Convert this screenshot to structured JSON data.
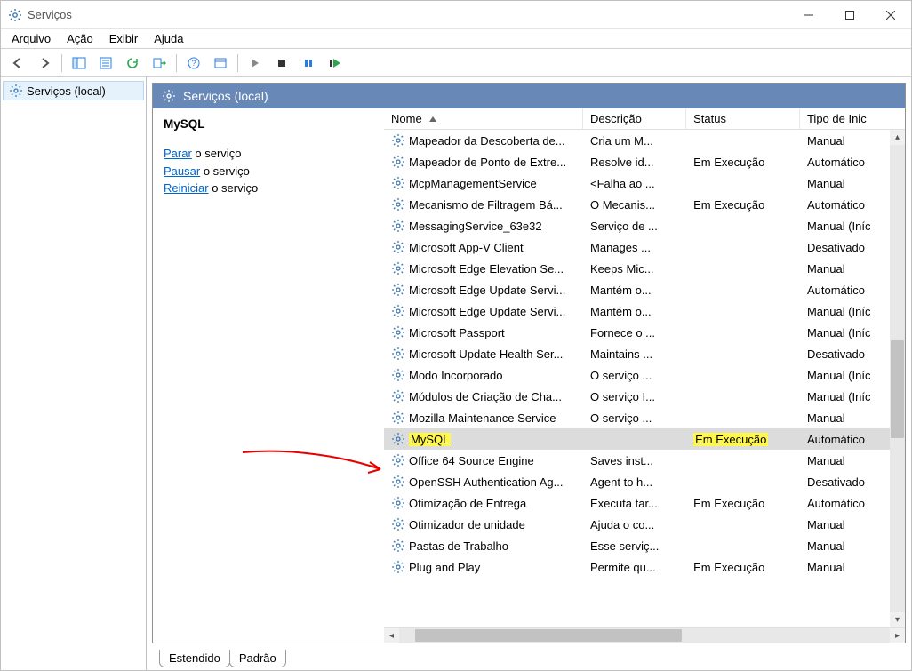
{
  "window": {
    "title": "Serviços"
  },
  "menu": {
    "file": "Arquivo",
    "action": "Ação",
    "view": "Exibir",
    "help": "Ajuda"
  },
  "tree": {
    "root": "Serviços (local)"
  },
  "pane": {
    "title": "Serviços (local)"
  },
  "detail": {
    "serviceName": "MySQL",
    "stopLink": "Parar",
    "stopText": " o serviço",
    "pauseLink": "Pausar",
    "pauseText": " o serviço",
    "restartLink": "Reiniciar",
    "restartText": " o serviço"
  },
  "columns": {
    "name": "Nome",
    "desc": "Descrição",
    "status": "Status",
    "start": "Tipo de Inic"
  },
  "tabs": {
    "extended": "Estendido",
    "standard": "Padrão"
  },
  "services": [
    {
      "name": "Mapeador da Descoberta de...",
      "desc": "Cria um M...",
      "status": "",
      "start": "Manual"
    },
    {
      "name": "Mapeador de Ponto de Extre...",
      "desc": "Resolve id...",
      "status": "Em Execução",
      "start": "Automático"
    },
    {
      "name": "McpManagementService",
      "desc": "<Falha ao ...",
      "status": "",
      "start": "Manual"
    },
    {
      "name": "Mecanismo de Filtragem Bá...",
      "desc": "O Mecanis...",
      "status": "Em Execução",
      "start": "Automático"
    },
    {
      "name": "MessagingService_63e32",
      "desc": "Serviço de ...",
      "status": "",
      "start": "Manual (Iníc"
    },
    {
      "name": "Microsoft App-V Client",
      "desc": "Manages ...",
      "status": "",
      "start": "Desativado"
    },
    {
      "name": "Microsoft Edge Elevation Se...",
      "desc": "Keeps Mic...",
      "status": "",
      "start": "Manual"
    },
    {
      "name": "Microsoft Edge Update Servi...",
      "desc": "Mantém o...",
      "status": "",
      "start": "Automático"
    },
    {
      "name": "Microsoft Edge Update Servi...",
      "desc": "Mantém o...",
      "status": "",
      "start": "Manual (Iníc"
    },
    {
      "name": "Microsoft Passport",
      "desc": "Fornece o ...",
      "status": "",
      "start": "Manual (Iníc"
    },
    {
      "name": "Microsoft Update Health Ser...",
      "desc": "Maintains ...",
      "status": "",
      "start": "Desativado"
    },
    {
      "name": "Modo Incorporado",
      "desc": "O serviço ...",
      "status": "",
      "start": "Manual (Iníc"
    },
    {
      "name": "Módulos de Criação de Cha...",
      "desc": "O serviço I...",
      "status": "",
      "start": "Manual (Iníc"
    },
    {
      "name": "Mozilla Maintenance Service",
      "desc": "O serviço ...",
      "status": "",
      "start": "Manual"
    },
    {
      "name": "MySQL",
      "desc": "",
      "status": "Em Execução",
      "start": "Automático",
      "highlight": true,
      "selected": true
    },
    {
      "name": "Office 64 Source Engine",
      "desc": "Saves inst...",
      "status": "",
      "start": "Manual"
    },
    {
      "name": "OpenSSH Authentication Ag...",
      "desc": "Agent to h...",
      "status": "",
      "start": "Desativado"
    },
    {
      "name": "Otimização de Entrega",
      "desc": "Executa tar...",
      "status": "Em Execução",
      "start": "Automático"
    },
    {
      "name": "Otimizador de unidade",
      "desc": "Ajuda o co...",
      "status": "",
      "start": "Manual"
    },
    {
      "name": "Pastas de Trabalho",
      "desc": "Esse serviç...",
      "status": "",
      "start": "Manual"
    },
    {
      "name": "Plug and Play",
      "desc": "Permite qu...",
      "status": "Em Execução",
      "start": "Manual"
    }
  ]
}
